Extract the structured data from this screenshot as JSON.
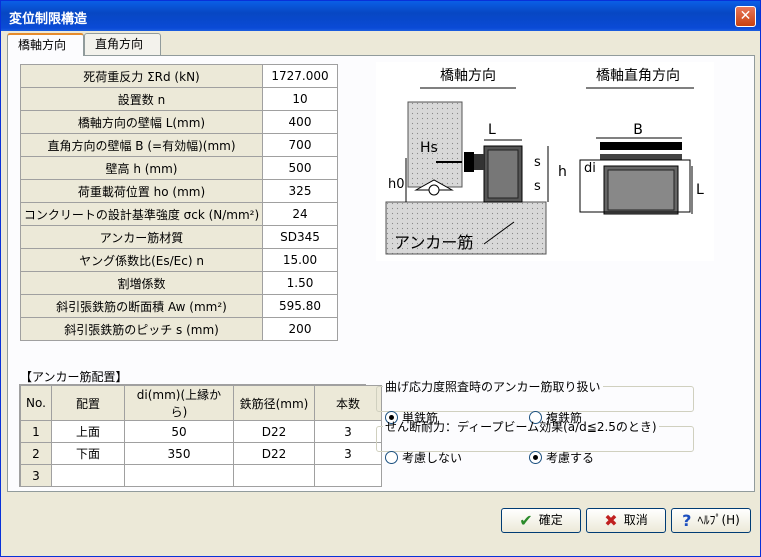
{
  "window": {
    "title": "変位制限構造",
    "close_label": "✕"
  },
  "tabs": [
    {
      "label": "橋軸方向",
      "active": true
    },
    {
      "label": "直角方向",
      "active": false
    }
  ],
  "params": [
    {
      "label": "死荷重反力 ΣRd (kN)",
      "value": "1727.000"
    },
    {
      "label": "設置数 n",
      "value": "10"
    },
    {
      "label": "橋軸方向の壁幅 L(mm)",
      "value": "400"
    },
    {
      "label": "直角方向の壁幅 B (=有効幅)(mm)",
      "value": "700"
    },
    {
      "label": "壁高 h (mm)",
      "value": "500"
    },
    {
      "label": "荷重載荷位置 ho (mm)",
      "value": "325"
    },
    {
      "label": "コンクリートの設計基準強度 σck (N/mm²)",
      "value": "24"
    },
    {
      "label": "アンカー筋材質",
      "value": "SD345"
    },
    {
      "label": "ヤング係数比(Es/Ec) n",
      "value": "15.00"
    },
    {
      "label": "割増係数",
      "value": "1.50"
    },
    {
      "label": "斜引張鉄筋の断面積 Aw (mm²)",
      "value": "595.80"
    },
    {
      "label": "斜引張鉄筋のピッチ s (mm)",
      "value": "200"
    }
  ],
  "diagram": {
    "left_title": "橋軸方向",
    "right_title": "橋軸直角方向",
    "label_L": "L",
    "label_B": "B",
    "label_Hs": "Hs",
    "label_h0": "h0",
    "label_h": "h",
    "label_s1": "s",
    "label_s2": "s",
    "label_di": "di",
    "label_L2": "L",
    "label_anchor": "アンカー筋"
  },
  "anchor": {
    "title": "【アンカー筋配置】",
    "headers": [
      "No.",
      "配置",
      "di(mm)(上縁から)",
      "鉄筋径(mm)",
      "本数"
    ],
    "rows": [
      {
        "no": "1",
        "pos": "上面",
        "di": "50",
        "dia": "D22",
        "count": "3"
      },
      {
        "no": "2",
        "pos": "下面",
        "di": "350",
        "dia": "D22",
        "count": "3"
      },
      {
        "no": "3",
        "pos": "",
        "di": "",
        "dia": "",
        "count": ""
      }
    ]
  },
  "bending": {
    "legend": "曲げ応力度照査時のアンカー筋取り扱い",
    "option1": "単鉄筋",
    "option2": "複鉄筋",
    "selected": "単鉄筋"
  },
  "shear": {
    "legend": "せん断耐力：ディープビーム効果(a/d≦2.5のとき)",
    "option1": "考慮しない",
    "option2": "考慮する",
    "selected": "考慮する"
  },
  "buttons": {
    "ok": "確定",
    "cancel": "取消",
    "help": "ﾍﾙﾌﾟ(H)"
  },
  "colors": {
    "titlebar": "#0747c3",
    "face": "#ece9d8",
    "tab_accent": "#e68b2c"
  }
}
